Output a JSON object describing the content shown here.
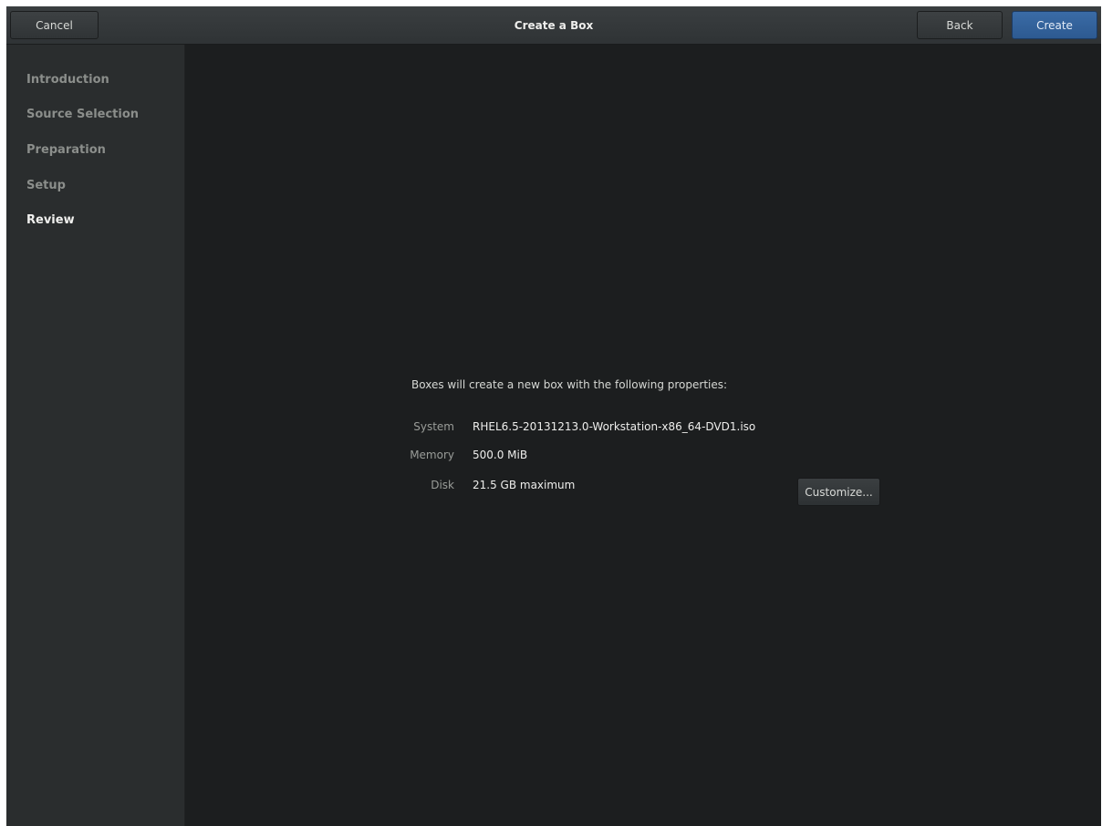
{
  "header": {
    "title": "Create a Box",
    "cancel_label": "Cancel",
    "back_label": "Back",
    "create_label": "Create"
  },
  "sidebar": {
    "items": [
      {
        "label": "Introduction",
        "active": false
      },
      {
        "label": "Source Selection",
        "active": false
      },
      {
        "label": "Preparation",
        "active": false
      },
      {
        "label": "Setup",
        "active": false
      },
      {
        "label": "Review",
        "active": true
      }
    ]
  },
  "review": {
    "intro": "Boxes will create a new box with the following properties:",
    "properties": [
      {
        "label": "System",
        "value": "RHEL6.5-20131213.0-Workstation-x86_64-DVD1.iso"
      },
      {
        "label": "Memory",
        "value": "500.0 MiB"
      },
      {
        "label": "Disk",
        "value": "21.5 GB maximum"
      }
    ],
    "customize_label": "Customize..."
  },
  "colors": {
    "accent": "#3a6ba6",
    "background": "#1c1e1f",
    "sidebar": "#2a2d2e"
  }
}
